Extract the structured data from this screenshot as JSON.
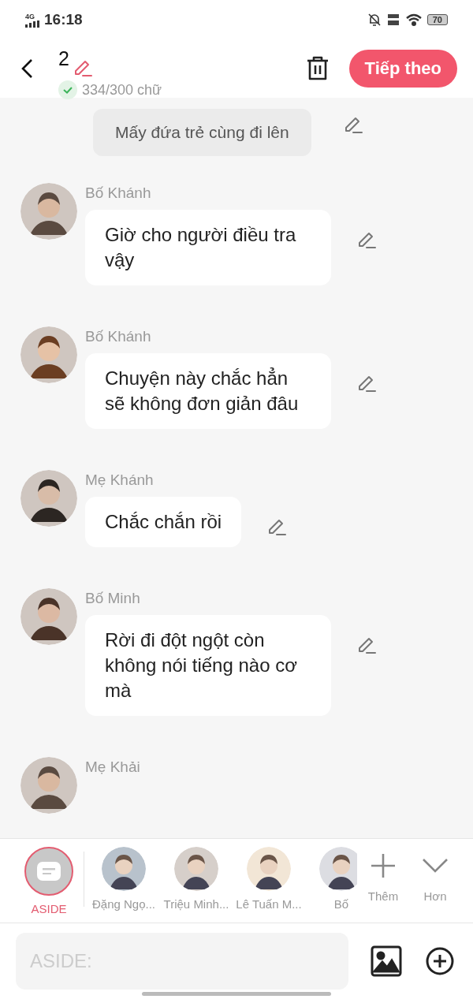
{
  "status_bar": {
    "network": "4G",
    "time": "16:18",
    "battery": "70"
  },
  "header": {
    "count": "2",
    "word_count": "334/300 chữ",
    "next_button": "Tiếp theo"
  },
  "messages": [
    {
      "kind": "aside",
      "text": "Mấy đứa trẻ cùng đi lên"
    },
    {
      "kind": "character",
      "name": "Bố Khánh",
      "text": "Giờ cho người điều tra vậy"
    },
    {
      "kind": "character",
      "name": "Bố Khánh",
      "text": "Chuyện này chắc hẳn sẽ không đơn giản đâu"
    },
    {
      "kind": "character",
      "name": "Mẹ Khánh",
      "text": "Chắc chắn rồi"
    },
    {
      "kind": "character",
      "name": "Bố Minh",
      "text": "Rời đi đột ngột còn không nói tiếng nào cơ mà"
    },
    {
      "kind": "character",
      "name": "Mẹ Khải"
    }
  ],
  "characters": [
    {
      "kind": "aside",
      "label": "ASIDE",
      "selected": true
    },
    {
      "kind": "character",
      "label": "Đặng Ngọ...",
      "selected": false
    },
    {
      "kind": "character",
      "label": "Triệu Minh...",
      "selected": false
    },
    {
      "kind": "character",
      "label": "Lê Tuấn M...",
      "selected": false
    },
    {
      "kind": "character",
      "label": "Bố",
      "selected": false
    }
  ],
  "actions": [
    {
      "kind": "add",
      "label": "Thêm"
    },
    {
      "kind": "more",
      "label": "Hơn"
    }
  ],
  "input": {
    "placeholder": "ASIDE:"
  }
}
